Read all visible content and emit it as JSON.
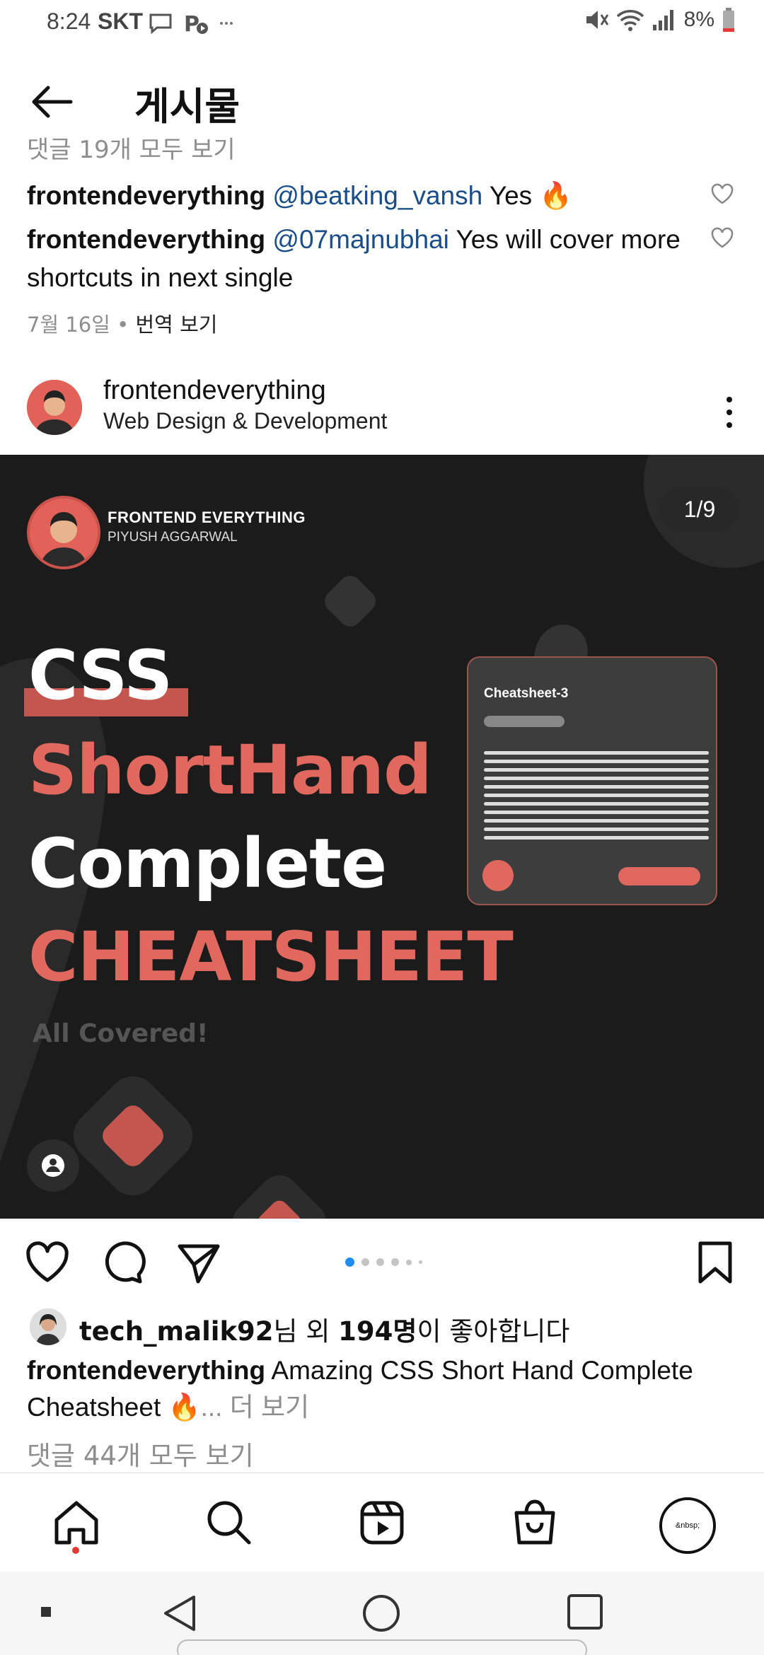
{
  "status_bar": {
    "time": "8:24",
    "carrier": "SKT",
    "battery": "8%"
  },
  "header": {
    "title": "게시물"
  },
  "comments": {
    "view_all_top": "댓글 19개 모두 보기",
    "items": [
      {
        "user": "frontendeverything",
        "mention": "@beatking_vansh",
        "text": "Yes 🔥"
      },
      {
        "user": "frontendeverything",
        "mention": "@07majnubhai",
        "text": "Yes will cover more shortcuts in next single"
      }
    ],
    "meta_date": "7월 16일",
    "meta_separator": " • ",
    "meta_translate": "번역 보기"
  },
  "post": {
    "username": "frontendeverything",
    "subtitle": "Web Design & Development",
    "image": {
      "brand_name": "FRONTEND EVERYTHING",
      "brand_sub": "PIYUSH AGGARWAL",
      "counter": "1/9",
      "line1": "CSS",
      "line2": "ShortHand",
      "line3": "Complete",
      "line4": "CHEATSHEET",
      "tagline": "All Covered!",
      "card_title": "Cheatsheet-3"
    },
    "likes": {
      "user": "tech_malik92",
      "mid": "님 외 ",
      "count": "194명",
      "suffix": "이 좋아합니다"
    },
    "caption": {
      "user": "frontendeverything",
      "text": "Amazing CSS Short Hand Complete Cheatsheet 🔥",
      "more": "... 더 보기"
    },
    "view_all_comments": "댓글 44개 모두 보기"
  },
  "bottom_nav": {
    "profile_label": "&nbsp;"
  },
  "colors": {
    "accent": "#e0685f",
    "mention": "#1a4e8a",
    "active_dot": "#1e8ef5",
    "post_bg": "#1b1b1b"
  }
}
